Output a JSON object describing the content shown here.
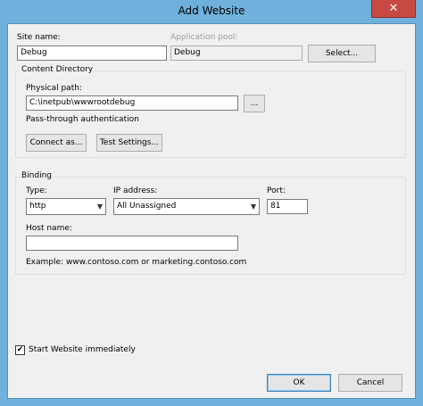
{
  "window": {
    "title": "Add Website",
    "close_glyph": "✕"
  },
  "site": {
    "name_label": "Site name:",
    "name_value": "Debug",
    "app_pool_label": "Application pool:",
    "app_pool_value": "Debug",
    "select_button": "Select..."
  },
  "content_directory": {
    "group_label": "Content Directory",
    "physical_path_label": "Physical path:",
    "physical_path_value": "C:\\inetpub\\wwwrootdebug",
    "browse_button": "...",
    "passthrough_label": "Pass-through authentication",
    "connect_as_button": "Connect as...",
    "test_settings_button": "Test Settings..."
  },
  "binding": {
    "group_label": "Binding",
    "type_label": "Type:",
    "type_value": "http",
    "ip_label": "IP address:",
    "ip_value": "All Unassigned",
    "port_label": "Port:",
    "port_value": "81",
    "host_label": "Host name:",
    "host_value": "",
    "example_text": "Example: www.contoso.com or marketing.contoso.com"
  },
  "start_website": {
    "label": "Start Website immediately",
    "checked": true,
    "check_glyph": "✔"
  },
  "footer": {
    "ok_button": "OK",
    "cancel_button": "Cancel"
  },
  "icons": {
    "dropdown_arrow": "▼"
  },
  "colors": {
    "titlebar": "#6fb1dc",
    "close_button": "#c74a42",
    "client_bg": "#f0f0f0"
  }
}
